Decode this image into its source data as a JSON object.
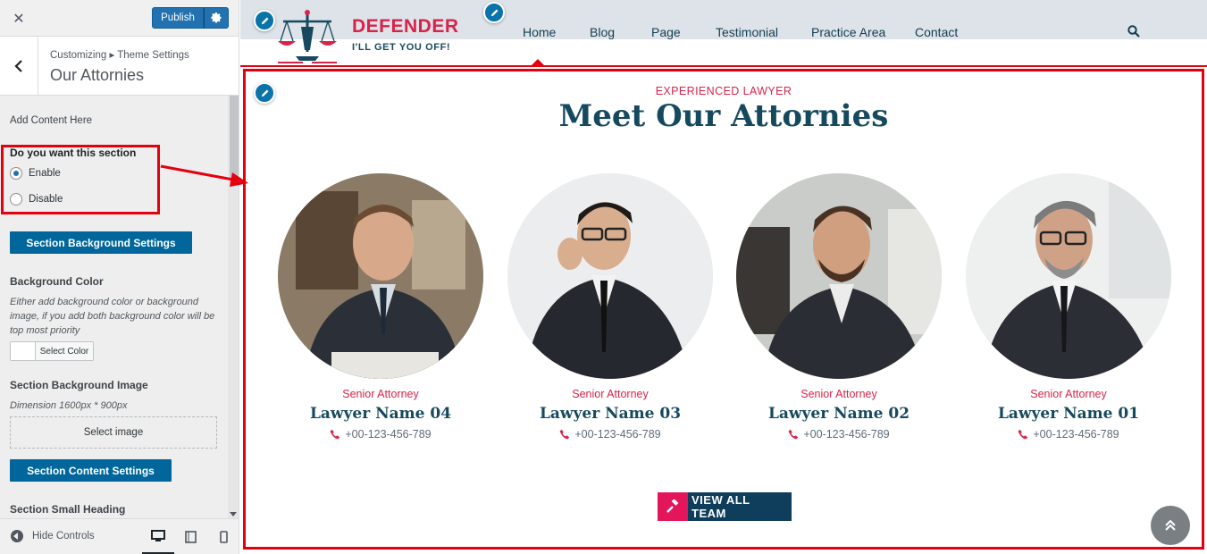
{
  "customizer": {
    "publish_label": "Publish",
    "breadcrumb": "Customizing ▸ Theme Settings",
    "section_title": "Our Attornies",
    "add_content": "Add Content Here",
    "radio_title": "Do you want this section",
    "radio_options": [
      "Enable",
      "Disable"
    ],
    "radio_selected": "Enable",
    "bg_settings_button": "Section Background Settings",
    "bg_color_label": "Background Color",
    "bg_color_desc": "Either add background color or background image, if you add both background color will be top most priority",
    "select_color": "Select Color",
    "bg_image_label": "Section Background Image",
    "bg_image_dimension": "Dimension 1600px * 900px",
    "select_image": "Select image",
    "content_settings_button": "Section Content Settings",
    "small_heading_label": "Section Small Heading",
    "hide_controls": "Hide Controls",
    "devices": [
      "desktop-icon",
      "tablet-icon",
      "mobile-icon"
    ]
  },
  "site": {
    "brand": "DEFENDER",
    "tagline": "I'LL GET YOU OFF!",
    "nav": [
      "Home",
      "Blog",
      "Page",
      "Testimonial",
      "Practice Area",
      "Contact"
    ],
    "active_nav": "Home"
  },
  "section": {
    "small_heading": "EXPERIENCED LAWYER",
    "heading": "Meet Our Attornies",
    "attorneys": [
      {
        "role": "Senior Attorney",
        "name": "Lawyer Name 04",
        "phone": "+00-123-456-789"
      },
      {
        "role": "Senior Attorney",
        "name": "Lawyer Name 03",
        "phone": "+00-123-456-789"
      },
      {
        "role": "Senior Attorney",
        "name": "Lawyer Name 02",
        "phone": "+00-123-456-789"
      },
      {
        "role": "Senior Attorney",
        "name": "Lawyer Name 01",
        "phone": "+00-123-456-789"
      }
    ],
    "cta_label": "VIEW ALL TEAM"
  },
  "colors": {
    "accent": "#d8234a",
    "navy": "#16495e",
    "wp_blue": "#2271b1",
    "highlight_red": "#e3000f"
  }
}
